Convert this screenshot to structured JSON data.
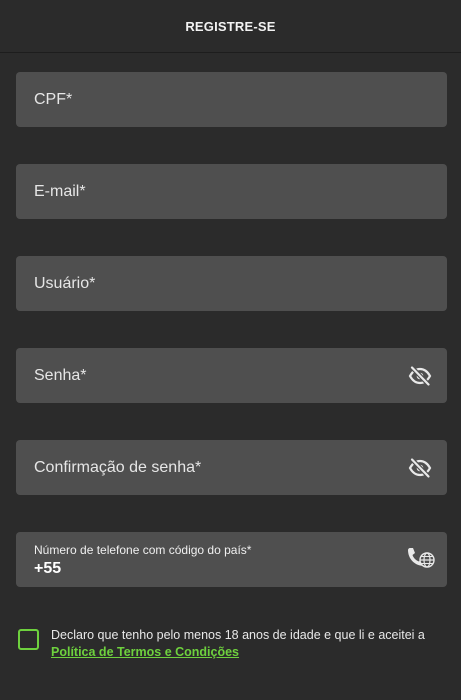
{
  "header": {
    "title": "REGISTRE-SE"
  },
  "form": {
    "cpf": {
      "placeholder": "CPF*",
      "value": ""
    },
    "email": {
      "placeholder": "E-mail*",
      "value": ""
    },
    "username": {
      "placeholder": "Usuário*",
      "value": ""
    },
    "password": {
      "placeholder": "Senha*",
      "value": "",
      "toggle_icon": "eye-off-icon"
    },
    "password_confirm": {
      "placeholder": "Confirmação de senha*",
      "value": "",
      "toggle_icon": "eye-off-icon"
    },
    "phone": {
      "label": "Número de telefone com código do país*",
      "value": "+55",
      "icon": "phone-globe-icon"
    }
  },
  "consent": {
    "checked": false,
    "text_before": "Declaro que tenho pelo menos 18 anos de idade e que li e aceitei a ",
    "link_text": "Política de Termos e Condições"
  },
  "colors": {
    "background": "#2b2b2b",
    "field_background": "#4f4f4f",
    "accent": "#6ed13e"
  }
}
